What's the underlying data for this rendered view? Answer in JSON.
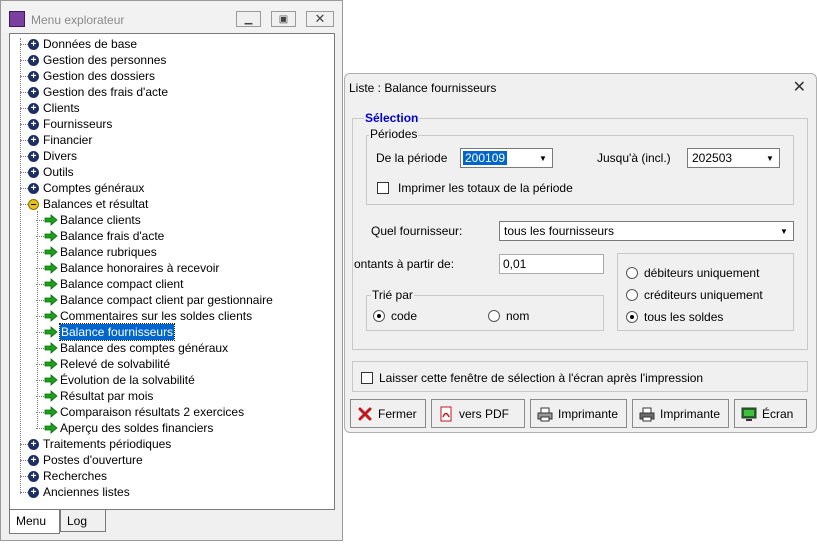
{
  "explorer": {
    "title": "Menu explorateur",
    "window_buttons": [
      "minimize",
      "restore",
      "close"
    ],
    "tree": [
      {
        "label": "Données de base",
        "level": 0,
        "icon": "plus-icon"
      },
      {
        "label": "Gestion des personnes",
        "level": 0,
        "icon": "plus-icon"
      },
      {
        "label": "Gestion des dossiers",
        "level": 0,
        "icon": "plus-icon"
      },
      {
        "label": "Gestion des frais d'acte",
        "level": 0,
        "icon": "plus-icon"
      },
      {
        "label": "Clients",
        "level": 0,
        "icon": "plus-icon"
      },
      {
        "label": "Fournisseurs",
        "level": 0,
        "icon": "plus-icon"
      },
      {
        "label": "Financier",
        "level": 0,
        "icon": "plus-icon"
      },
      {
        "label": "Divers",
        "level": 0,
        "icon": "plus-icon"
      },
      {
        "label": "Outils",
        "level": 0,
        "icon": "plus-icon"
      },
      {
        "label": "Comptes généraux",
        "level": 0,
        "icon": "plus-icon"
      },
      {
        "label": "Balances et résultat",
        "level": 0,
        "icon": "minus-icon"
      },
      {
        "label": "Balance clients",
        "level": 1,
        "icon": "green-arrow-icon"
      },
      {
        "label": "Balance frais d'acte",
        "level": 1,
        "icon": "green-arrow-icon"
      },
      {
        "label": "Balance rubriques",
        "level": 1,
        "icon": "green-arrow-icon"
      },
      {
        "label": "Balance honoraires à recevoir",
        "level": 1,
        "icon": "green-arrow-icon"
      },
      {
        "label": "Balance compact client",
        "level": 1,
        "icon": "green-arrow-icon"
      },
      {
        "label": "Balance compact client par gestionnaire",
        "level": 1,
        "icon": "green-arrow-icon"
      },
      {
        "label": "Commentaires sur les soldes clients",
        "level": 1,
        "icon": "green-arrow-icon"
      },
      {
        "label": "Balance fournisseurs",
        "level": 1,
        "icon": "green-arrow-icon",
        "selected": true
      },
      {
        "label": "Balance des comptes généraux",
        "level": 1,
        "icon": "green-arrow-icon"
      },
      {
        "label": "Relevé de solvabilité",
        "level": 1,
        "icon": "green-arrow-icon"
      },
      {
        "label": "Évolution de la solvabilité",
        "level": 1,
        "icon": "green-arrow-icon"
      },
      {
        "label": "Résultat par mois",
        "level": 1,
        "icon": "green-arrow-icon"
      },
      {
        "label": "Comparaison résultats 2 exercices",
        "level": 1,
        "icon": "green-arrow-icon"
      },
      {
        "label": "Aperçu des soldes financiers",
        "level": 1,
        "icon": "green-arrow-icon"
      },
      {
        "label": "Traitements périodiques",
        "level": 0,
        "icon": "plus-icon"
      },
      {
        "label": "Postes d'ouverture",
        "level": 0,
        "icon": "plus-icon"
      },
      {
        "label": "Recherches",
        "level": 0,
        "icon": "plus-icon"
      },
      {
        "label": "Anciennes listes",
        "level": 0,
        "icon": "plus-icon"
      }
    ],
    "tabs": [
      {
        "label": "Menu",
        "active": true
      },
      {
        "label": "Log",
        "active": false
      }
    ]
  },
  "dialog": {
    "title": "Liste : Balance fournisseurs",
    "selection_legend": "Sélection",
    "periods_legend": "Périodes",
    "from_label": "De la période",
    "from_value": "200109",
    "to_label": "Jusqu'à (incl.)",
    "to_value": "202503",
    "print_totals_label": "Imprimer les totaux de la période",
    "print_totals_checked": false,
    "supplier_label": "Quel fournisseur:",
    "supplier_value": "tous les fournisseurs",
    "amounts_label": "ontants à partir de:",
    "amounts_value": "0,01",
    "balance_options": [
      {
        "label": "débiteurs uniquement",
        "checked": false
      },
      {
        "label": "créditeurs uniquement",
        "checked": false
      },
      {
        "label": "tous les soldes",
        "checked": true
      }
    ],
    "sort_legend": "Trié par",
    "sort_options": [
      {
        "label": "code",
        "checked": true
      },
      {
        "label": "nom",
        "checked": false
      }
    ],
    "keep_window_label": "Laisser cette fenêtre de sélection à l'écran après l'impression",
    "keep_window_checked": false,
    "buttons": {
      "close": "Fermer",
      "pdf": "vers PDF",
      "printer1": "Imprimante",
      "printer2": "Imprimante",
      "screen": "Écran"
    }
  },
  "colors": {
    "selection": "#0066cc",
    "legend_blue": "#0000cc",
    "arrow_green": "#1aa01a",
    "plus_blue": "#1e2f66"
  }
}
